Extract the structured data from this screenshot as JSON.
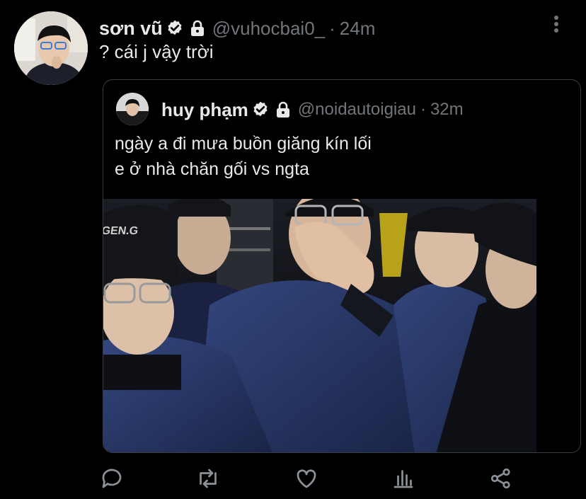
{
  "tweet": {
    "author_name": "sơn vũ",
    "handle": "@vuhocbai0_",
    "separator": "·",
    "time": "24m",
    "text": "? cái j vậy trời"
  },
  "quote": {
    "author_name": "huy phạm",
    "handle": "@noidautoigiau",
    "separator": "·",
    "time": "32m",
    "text_lines": [
      "ngày a đi mưa buồn giăng kín lối",
      "e ở nhà chăn gối vs ngta"
    ]
  },
  "actions": [
    "reply-icon",
    "retweet-icon",
    "like-icon",
    "analytics-icon",
    "share-icon"
  ],
  "colors": {
    "background": "#000000",
    "text": "#e7e9ea",
    "secondary": "#71767b",
    "border": "#3a3d41",
    "jacket": "#2b3a6b"
  }
}
